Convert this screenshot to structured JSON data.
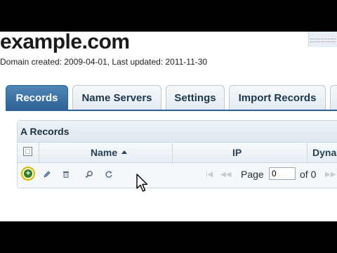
{
  "domain": {
    "name": "example.com",
    "meta": "Domain created: 2009-04-01, Last updated: 2011-11-30"
  },
  "tabs": [
    {
      "label": "Records",
      "active": true
    },
    {
      "label": "Name Servers",
      "active": false
    },
    {
      "label": "Settings",
      "active": false
    },
    {
      "label": "Import Records",
      "active": false
    }
  ],
  "panel": {
    "title": "A Records",
    "columns": [
      "Name",
      "IP",
      "Dyna"
    ],
    "sort": {
      "column": "Name",
      "direction": "ascending"
    }
  },
  "toolbar": {
    "icons": [
      "add-icon",
      "edit-icon",
      "delete-icon",
      "search-icon",
      "refresh-icon"
    ]
  },
  "pager": {
    "page_label": "Page",
    "page_value": "0",
    "of_label": "of 0"
  },
  "colors": {
    "active_tab": "#2d6396",
    "highlight": "#d8b800"
  }
}
